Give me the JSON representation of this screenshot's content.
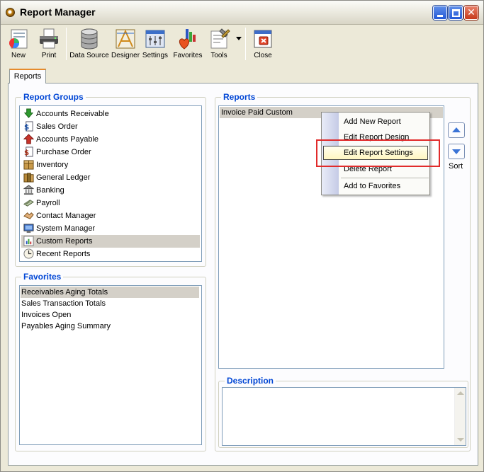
{
  "window": {
    "title": "Report Manager"
  },
  "toolbar": {
    "buttons": [
      {
        "label": "New",
        "icon": "new-report-icon"
      },
      {
        "label": "Print",
        "icon": "printer-icon"
      },
      {
        "label": "Data Source",
        "icon": "database-icon"
      },
      {
        "label": "Designer",
        "icon": "designer-icon"
      },
      {
        "label": "Settings",
        "icon": "settings-icon"
      },
      {
        "label": "Favorites",
        "icon": "favorites-icon"
      },
      {
        "label": "Tools",
        "icon": "tools-icon"
      },
      {
        "label": "Close",
        "icon": "close-report-icon"
      }
    ]
  },
  "tabs": [
    {
      "label": "Reports",
      "active": true
    }
  ],
  "report_groups": {
    "title": "Report Groups",
    "items": [
      {
        "label": "Accounts Receivable",
        "icon": "accounts-receivable-icon"
      },
      {
        "label": "Sales Order",
        "icon": "sales-order-icon"
      },
      {
        "label": "Accounts Payable",
        "icon": "accounts-payable-icon"
      },
      {
        "label": "Purchase Order",
        "icon": "purchase-order-icon"
      },
      {
        "label": "Inventory",
        "icon": "inventory-icon"
      },
      {
        "label": "General Ledger",
        "icon": "general-ledger-icon"
      },
      {
        "label": "Banking",
        "icon": "bank-icon"
      },
      {
        "label": "Payroll",
        "icon": "payroll-icon"
      },
      {
        "label": "Contact Manager",
        "icon": "contact-manager-icon"
      },
      {
        "label": "System Manager",
        "icon": "monitor-icon"
      },
      {
        "label": "Custom Reports",
        "icon": "custom-reports-icon",
        "selected": true
      },
      {
        "label": "Recent Reports",
        "icon": "clock-icon"
      }
    ]
  },
  "favorites": {
    "title": "Favorites",
    "items": [
      {
        "label": "Receivables Aging Totals",
        "selected": true
      },
      {
        "label": "Sales Transaction Totals"
      },
      {
        "label": "Invoices Open"
      },
      {
        "label": "Payables Aging Summary"
      }
    ]
  },
  "reports": {
    "title": "Reports",
    "items": [
      {
        "label": "Invoice Paid Custom",
        "selected": true
      }
    ],
    "sort_label": "Sort"
  },
  "context_menu": {
    "items": [
      {
        "label": "Add New Report"
      },
      {
        "label": "Edit Report Design"
      },
      {
        "label": "Edit Report Settings",
        "highlighted": true
      },
      {
        "label": "Delete Report"
      },
      {
        "label": "Add to Favorites"
      }
    ]
  },
  "description": {
    "title": "Description",
    "text": ""
  },
  "colors": {
    "group_title": "#0046d5",
    "highlight_box": "#e12b2b",
    "tab_accent": "#e68b2c"
  }
}
